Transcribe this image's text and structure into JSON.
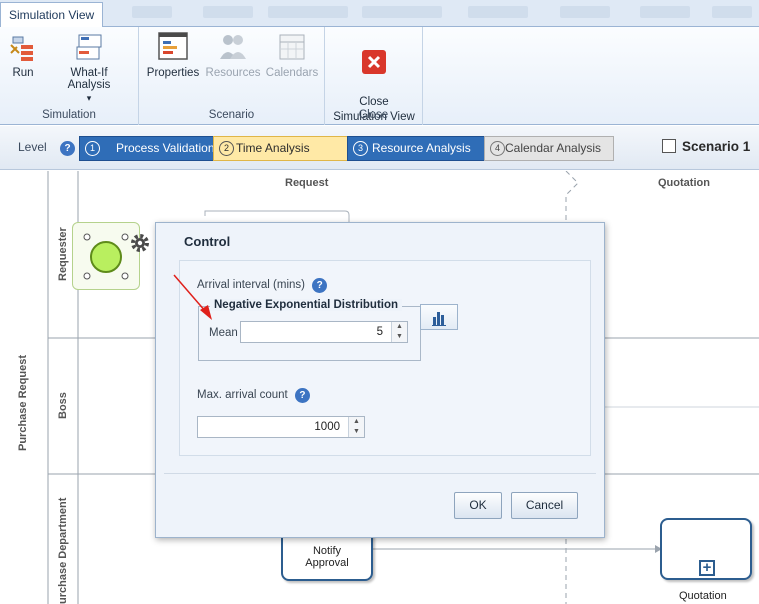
{
  "tabs": {
    "active": "Simulation View"
  },
  "ribbon": {
    "simulation": {
      "title": "Simulation",
      "run": "Run",
      "what_if": "What-If Analysis",
      "what_if_arrow": "▾"
    },
    "scenario": {
      "title": "Scenario",
      "properties": "Properties",
      "resources": "Resources",
      "calendars": "Calendars"
    },
    "close": {
      "title": "Close",
      "close_label": "Close\nSimulation View"
    }
  },
  "levelbar": {
    "label": "Level",
    "help": "?",
    "steps": [
      {
        "num": "1",
        "label": "Process Validation",
        "state": "done"
      },
      {
        "num": "2",
        "label": "Time Analysis",
        "state": "current"
      },
      {
        "num": "3",
        "label": "Resource Analysis",
        "state": "done"
      },
      {
        "num": "4",
        "label": "Calendar Analysis",
        "state": "pending"
      }
    ],
    "scenario": "Scenario 1"
  },
  "canvas": {
    "pool": "Purchase Request",
    "lanes": [
      "Requester",
      "Boss",
      "urchase Department"
    ],
    "columns": [
      "Request",
      "Quotation"
    ],
    "tasks": {
      "notify_approval": "Notify\nApproval",
      "quotation": "Quotation"
    }
  },
  "dialog": {
    "title": "Control",
    "arrival_label": "Arrival interval (mins)",
    "distribution_legend": "Negative Exponential Distribution",
    "mean_label": "Mean",
    "mean_value": "5",
    "max_label": "Max. arrival count",
    "max_value": "1000",
    "ok": "OK",
    "cancel": "Cancel"
  },
  "colors": {
    "accent": "#2f6db7",
    "current_step": "#ffe9a6",
    "annotation_arrow": "#e0201b"
  }
}
